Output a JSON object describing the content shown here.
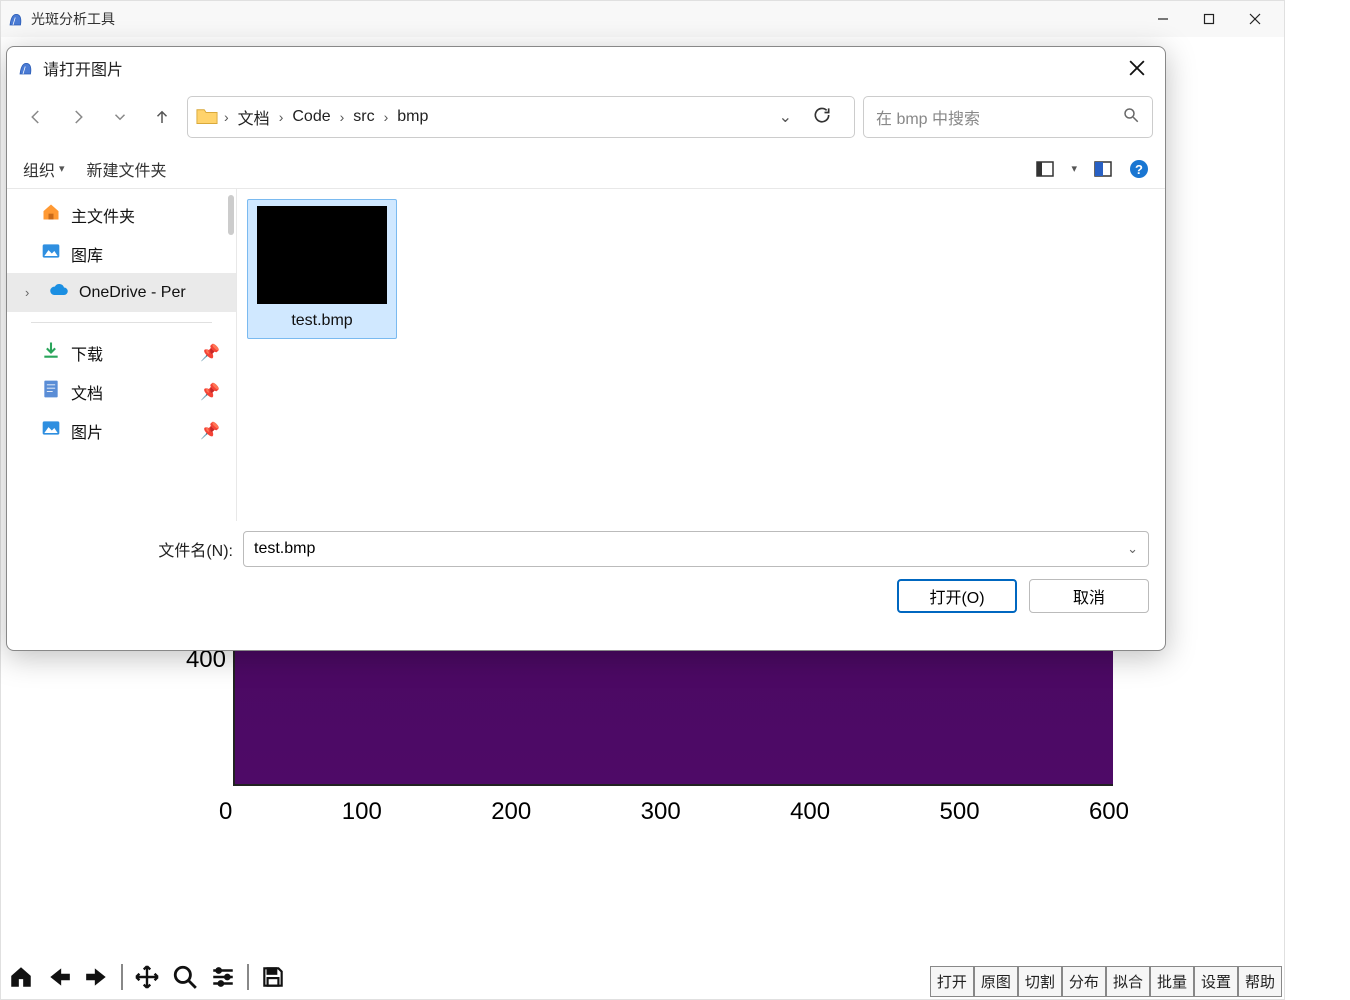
{
  "main_window": {
    "title": "光斑分析工具"
  },
  "dialog": {
    "title": "请打开图片",
    "breadcrumb": [
      "文档",
      "Code",
      "src",
      "bmp"
    ],
    "search_placeholder": "在 bmp 中搜索",
    "toolbar": {
      "organize": "组织",
      "new_folder": "新建文件夹"
    },
    "sidebar": {
      "home": "主文件夹",
      "gallery": "图库",
      "onedrive": "OneDrive - Per",
      "downloads": "下载",
      "documents": "文档",
      "pictures": "图片"
    },
    "file": {
      "name": "test.bmp"
    },
    "filename_label": "文件名(N):",
    "filename_value": "test.bmp",
    "open_btn": "打开(O)",
    "cancel_btn": "取消"
  },
  "app_buttons": [
    "打开",
    "原图",
    "切割",
    "分布",
    "拟合",
    "批量",
    "设置",
    "帮助"
  ],
  "chart_data": {
    "type": "heatmap",
    "title": "",
    "xlabel": "",
    "ylabel": "",
    "xlim": [
      0,
      640
    ],
    "ylim": [
      0,
      480
    ],
    "x_ticks": [
      0,
      100,
      200,
      300,
      400,
      500,
      600
    ],
    "y_visible_ticks": [
      400
    ],
    "note": "Uniform near-zero intensity image (purple viridis low end); upper portion occluded by dialog in screenshot"
  }
}
